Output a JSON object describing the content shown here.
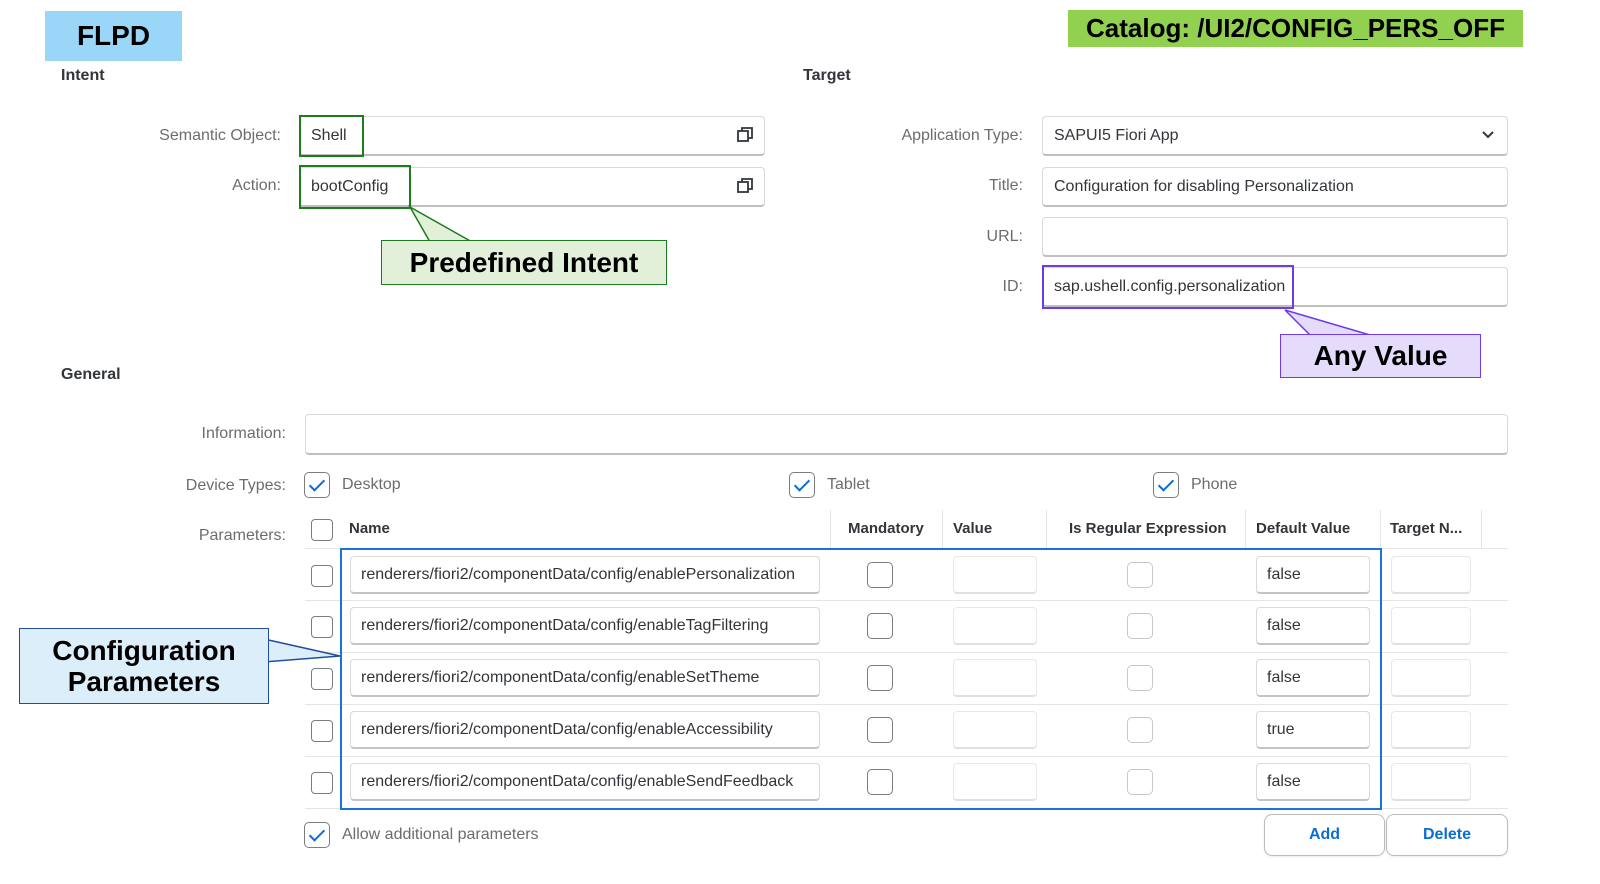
{
  "badges": {
    "flpd": "FLPD",
    "catalog": "Catalog: /UI2/CONFIG_PERS_OFF"
  },
  "intent": {
    "title": "Intent",
    "semantic_object_label": "Semantic Object:",
    "semantic_object_value": "Shell",
    "action_label": "Action:",
    "action_value": "bootConfig"
  },
  "target": {
    "title": "Target",
    "app_type_label": "Application Type:",
    "app_type_value": "SAPUI5 Fiori App",
    "title_label": "Title:",
    "title_value": "Configuration for disabling Personalization",
    "url_label": "URL:",
    "url_value": "",
    "id_label": "ID:",
    "id_value": "sap.ushell.config.personalization"
  },
  "general": {
    "title": "General",
    "information_label": "Information:",
    "information_value": "",
    "device_types_label": "Device Types:",
    "devices": [
      {
        "label": "Desktop",
        "checked": true
      },
      {
        "label": "Tablet",
        "checked": true
      },
      {
        "label": "Phone",
        "checked": true
      }
    ],
    "parameters_label": "Parameters:"
  },
  "parameters_table": {
    "columns": [
      "Name",
      "Mandatory",
      "Value",
      "Is Regular Expression",
      "Default Value",
      "Target N..."
    ],
    "rows": [
      {
        "name": "renderers/fiori2/componentData/config/enablePersonalization",
        "mandatory": false,
        "value": "",
        "is_regex": false,
        "default_value": "false",
        "target_name": ""
      },
      {
        "name": "renderers/fiori2/componentData/config/enableTagFiltering",
        "mandatory": false,
        "value": "",
        "is_regex": false,
        "default_value": "false",
        "target_name": ""
      },
      {
        "name": "renderers/fiori2/componentData/config/enableSetTheme",
        "mandatory": false,
        "value": "",
        "is_regex": false,
        "default_value": "false",
        "target_name": ""
      },
      {
        "name": "renderers/fiori2/componentData/config/enableAccessibility",
        "mandatory": false,
        "value": "",
        "is_regex": false,
        "default_value": "true",
        "target_name": ""
      },
      {
        "name": "renderers/fiori2/componentData/config/enableSendFeedback",
        "mandatory": false,
        "value": "",
        "is_regex": false,
        "default_value": "false",
        "target_name": ""
      }
    ],
    "allow_additional_label": "Allow additional parameters",
    "allow_additional_checked": true,
    "add_button": "Add",
    "delete_button": "Delete"
  },
  "callouts": {
    "predefined_intent": "Predefined Intent",
    "any_value": "Any Value",
    "configuration_parameters": "Configuration Parameters"
  },
  "colors": {
    "flpd_badge": "#99d6f7",
    "catalog_badge": "#92d050",
    "predefined_intent_fill": "#e2efd9",
    "predefined_intent_border": "#1e7b1e",
    "any_value_fill": "#e4dcfa",
    "any_value_border": "#6f3be8",
    "config_params_fill": "#ddeefb",
    "config_params_border": "#1f4e9a",
    "highlight_blue": "#1a73d9",
    "accent": "#0a6ed1"
  }
}
